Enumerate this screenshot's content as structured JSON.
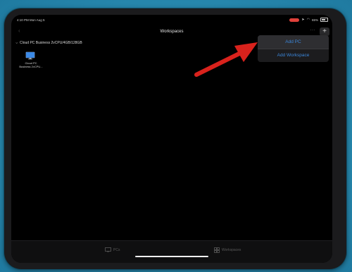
{
  "status_bar": {
    "time": "4:10 PM  Mon Aug 5",
    "battery": "65%"
  },
  "nav": {
    "title": "Workspaces",
    "back_glyph": "‹",
    "more_glyph": "⋯",
    "add_glyph": "+"
  },
  "group": {
    "title": "Cloud PC Business 2vCPU/4GB/128GB"
  },
  "pc_tile": {
    "label_line1": "Cloud PC",
    "label_line2": "Business 2vCPU..."
  },
  "menu": {
    "items": [
      "Add PC",
      "Add Workspace"
    ]
  },
  "tabs": [
    {
      "label": "PCs",
      "icon": "pc-icon"
    },
    {
      "label": "Workspaces",
      "icon": "workspaces-icon"
    }
  ],
  "colors": {
    "background": "#2c8fb3",
    "accent_link": "#3b86d9",
    "arrow": "#d9211e",
    "recording_pill": "#e0413a"
  }
}
